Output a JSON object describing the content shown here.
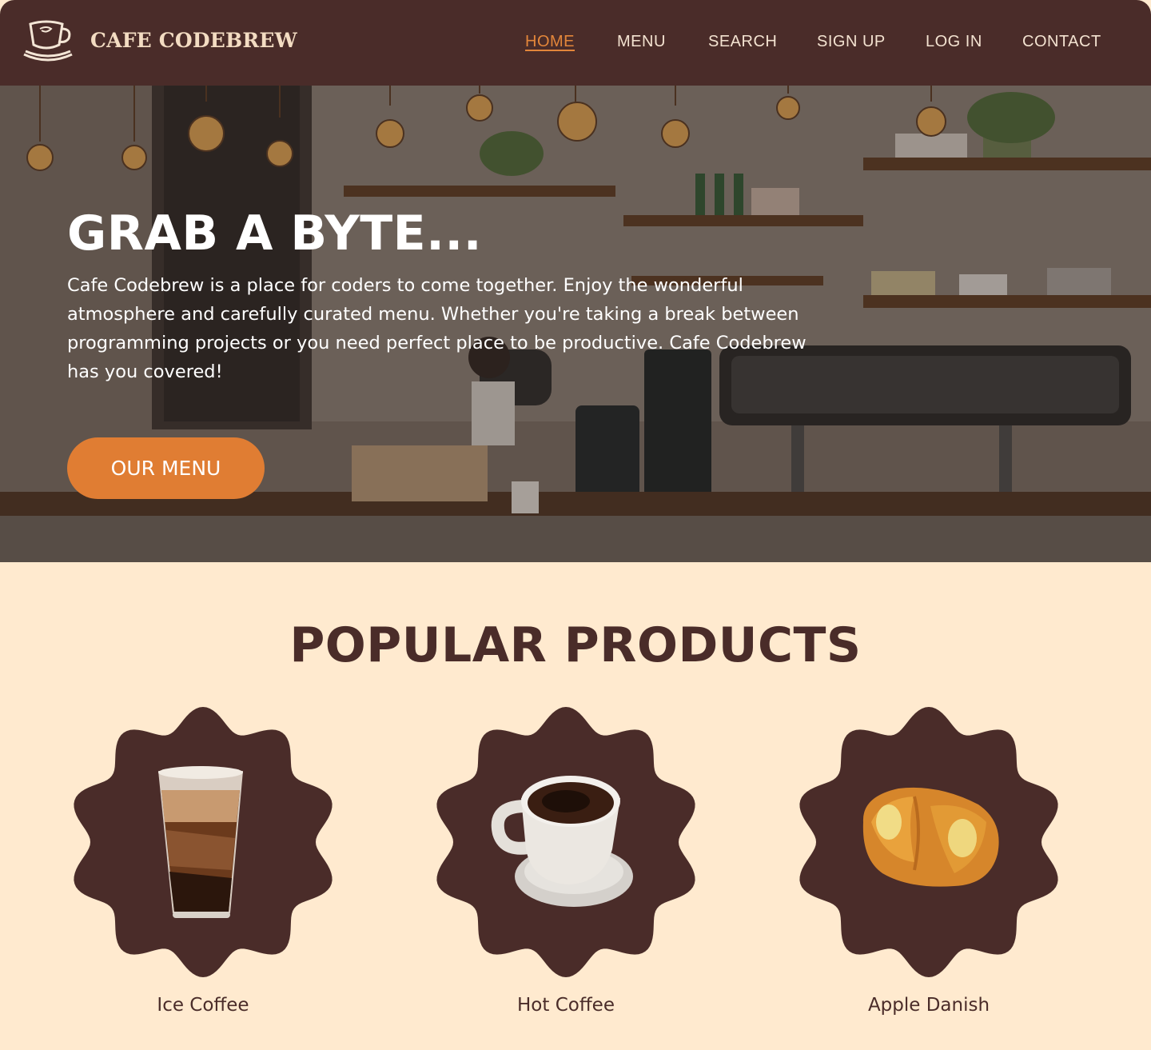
{
  "nav": {
    "brand": "CAFE CODEBREW",
    "logo_icon": "coffee-cup-icon",
    "links": [
      {
        "label": "HOME",
        "active": true
      },
      {
        "label": "MENU",
        "active": false
      },
      {
        "label": "SEARCH",
        "active": false
      },
      {
        "label": "SIGN UP",
        "active": false
      },
      {
        "label": "LOG IN",
        "active": false
      },
      {
        "label": "CONTACT",
        "active": false
      }
    ]
  },
  "hero": {
    "title": "GRAB A BYTE...",
    "text": "Cafe Codebrew is a place for coders to come together. Enjoy the wonderful atmosphere and carefully curated menu. Whether you're taking a break between programming projects or you need perfect place to be productive. Cafe Codebrew has you covered!",
    "button_label": "OUR MENU"
  },
  "products": {
    "title": "POPULAR PRODUCTS",
    "items": [
      {
        "name": "Ice Coffee",
        "image": "iced-coffee-image"
      },
      {
        "name": "Hot Coffee",
        "image": "hot-coffee-image"
      },
      {
        "name": "Apple Danish",
        "image": "apple-danish-image"
      }
    ]
  },
  "colors": {
    "brown": "#4a2c29",
    "accent": "#e07d33",
    "cream": "#ffeacf"
  }
}
